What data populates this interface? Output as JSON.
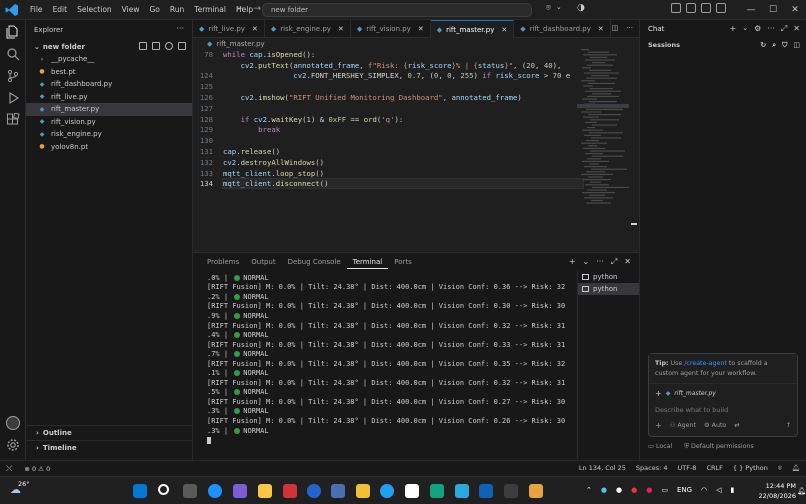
{
  "menu": [
    "File",
    "Edit",
    "Selection",
    "View",
    "Go",
    "Run",
    "Terminal",
    "Help"
  ],
  "command_center": "new folder",
  "explorer": {
    "title": "Explorer",
    "folder": "new folder",
    "items": [
      {
        "name": "__pycache__",
        "type": "folder"
      },
      {
        "name": "best.pt",
        "type": "pt"
      },
      {
        "name": "rift_dashboard.py",
        "type": "py"
      },
      {
        "name": "rift_live.py",
        "type": "py"
      },
      {
        "name": "rift_master.py",
        "type": "py",
        "selected": true
      },
      {
        "name": "rift_vision.py",
        "type": "py"
      },
      {
        "name": "risk_engine.py",
        "type": "py"
      },
      {
        "name": "yolov8n.pt",
        "type": "pt"
      }
    ],
    "outline": "Outline",
    "timeline": "Timeline"
  },
  "tabs": [
    {
      "label": "rift_live.py",
      "active": false
    },
    {
      "label": "risk_engine.py",
      "active": false
    },
    {
      "label": "rift_vision.py",
      "active": false
    },
    {
      "label": "rift_master.py",
      "active": true
    },
    {
      "label": "rift_dashboard.py",
      "active": false
    }
  ],
  "breadcrumb": "rift_master.py",
  "code": [
    {
      "n": "78",
      "t": "while cap.isOpened():"
    },
    {
      "n": "",
      "t": "    cv2.putText(annotated_frame, f\"Risk: {risk_score}% | {status}\", (20, 40),"
    },
    {
      "n": "124",
      "t": "                cv2.FONT_HERSHEY_SIMPLEX, 0.7, (0, 0, 255) if risk_score > 70 e"
    },
    {
      "n": "125",
      "t": ""
    },
    {
      "n": "126",
      "t": "    cv2.imshow(\"RIFT Unified Monitoring Dashboard\", annotated_frame)"
    },
    {
      "n": "127",
      "t": ""
    },
    {
      "n": "128",
      "t": "    if cv2.waitKey(1) & 0xFF == ord('q'):"
    },
    {
      "n": "129",
      "t": "        break"
    },
    {
      "n": "130",
      "t": ""
    },
    {
      "n": "131",
      "t": "cap.release()"
    },
    {
      "n": "132",
      "t": "cv2.destroyAllWindows()"
    },
    {
      "n": "133",
      "t": "mqtt_client.loop_stop()"
    },
    {
      "n": "134",
      "t": "mqtt_client.disconnect()"
    }
  ],
  "panel_tabs": [
    {
      "label": "Problems",
      "active": false
    },
    {
      "label": "Output",
      "active": false
    },
    {
      "label": "Debug Console",
      "active": false
    },
    {
      "label": "Terminal",
      "active": true
    },
    {
      "label": "Ports",
      "active": false
    }
  ],
  "terminal_lines": [
    {
      "t": ".0% | ",
      "dot": true,
      "s": "NORMAL"
    },
    {
      "t": "[RIFT Fusion] M: 0.0% | Tilt: 24.38° | Dist: 400.0cm | Vision Conf: 0.36 --> Risk: 32",
      "dot": false,
      "s": ""
    },
    {
      "t": ".2% | ",
      "dot": true,
      "s": "NORMAL"
    },
    {
      "t": "[RIFT Fusion] M: 0.0% | Tilt: 24.38° | Dist: 400.0cm | Vision Conf: 0.30 --> Risk: 30",
      "dot": false,
      "s": ""
    },
    {
      "t": ".9% | ",
      "dot": true,
      "s": "NORMAL"
    },
    {
      "t": "[RIFT Fusion] M: 0.0% | Tilt: 24.38° | Dist: 400.0cm | Vision Conf: 0.32 --> Risk: 31",
      "dot": false,
      "s": ""
    },
    {
      "t": ".4% | ",
      "dot": true,
      "s": "NORMAL"
    },
    {
      "t": "[RIFT Fusion] M: 0.0% | Tilt: 24.38° | Dist: 400.0cm | Vision Conf: 0.33 --> Risk: 31",
      "dot": false,
      "s": ""
    },
    {
      "t": ".7% | ",
      "dot": true,
      "s": "NORMAL"
    },
    {
      "t": "[RIFT Fusion] M: 0.0% | Tilt: 24.38° | Dist: 400.0cm | Vision Conf: 0.35 --> Risk: 32",
      "dot": false,
      "s": ""
    },
    {
      "t": ".1% | ",
      "dot": true,
      "s": "NORMAL"
    },
    {
      "t": "[RIFT Fusion] M: 0.0% | Tilt: 24.38° | Dist: 400.0cm | Vision Conf: 0.32 --> Risk: 31",
      "dot": false,
      "s": ""
    },
    {
      "t": ".5% | ",
      "dot": true,
      "s": "NORMAL"
    },
    {
      "t": "[RIFT Fusion] M: 0.0% | Tilt: 24.38° | Dist: 400.0cm | Vision Conf: 0.27 --> Risk: 30",
      "dot": false,
      "s": ""
    },
    {
      "t": ".3% | ",
      "dot": true,
      "s": "NORMAL"
    },
    {
      "t": "[RIFT Fusion] M: 0.0% | Tilt: 24.38° | Dist: 400.0cm | Vision Conf: 0.26 --> Risk: 30",
      "dot": false,
      "s": ""
    },
    {
      "t": ".3% | ",
      "dot": true,
      "s": "NORMAL"
    }
  ],
  "terminal_list": [
    {
      "label": "python",
      "selected": false
    },
    {
      "label": "python",
      "selected": true
    }
  ],
  "chat": {
    "title": "Chat",
    "sessions": "Sessions",
    "tip_prefix": "Tip:",
    "tip_use": "Use",
    "tip_link": "/create-agent",
    "tip_rest": "to scaffold a custom agent for your workflow.",
    "context_file": "rift_master.py",
    "placeholder": "Describe what to build",
    "mode": "Agent",
    "auto": "Auto",
    "local": "Local",
    "permissions": "Default permissions"
  },
  "status": {
    "errors": "0",
    "warnings": "0",
    "position": "Ln 134, Col 25",
    "spaces": "Spaces: 4",
    "encoding": "UTF-8",
    "eol": "CRLF",
    "language": "Python",
    "language_prefix": "{ }"
  },
  "taskbar": {
    "temp": "26°",
    "lang": "ENG",
    "time": "12:44 PM",
    "date": "22/08/2026"
  },
  "colors": {
    "accent": "#0078d4",
    "normal_dot": "#2ea043",
    "python_icon": "#519aba"
  }
}
